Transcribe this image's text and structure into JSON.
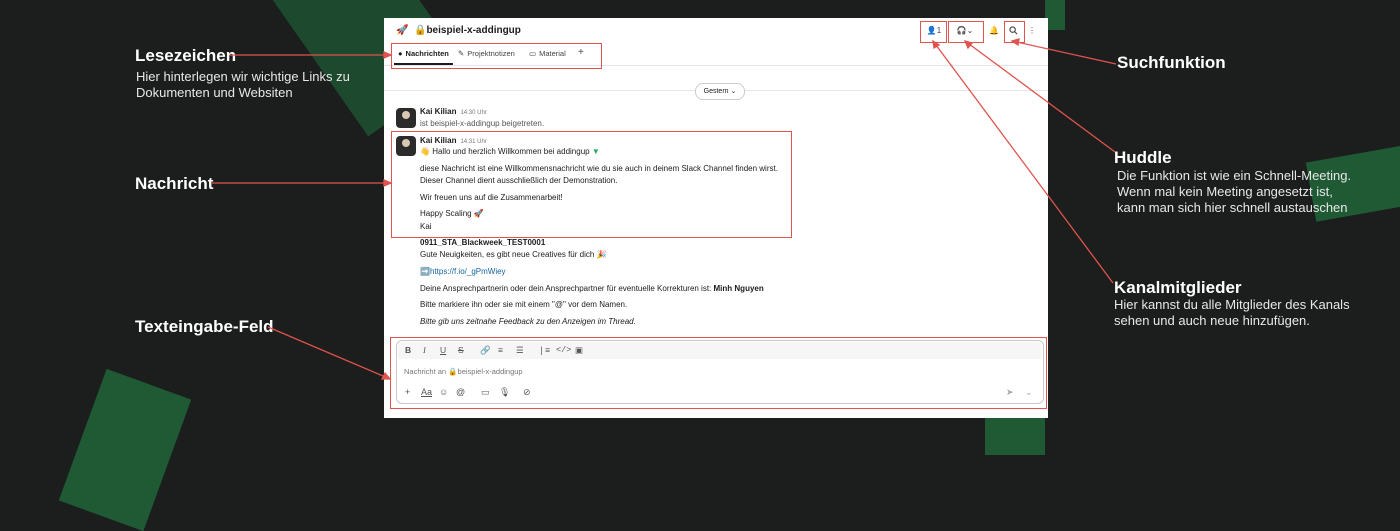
{
  "annotations": {
    "lesezeichen": {
      "title": "Lesezeichen",
      "desc_line1": "Hier hinterlegen wir wichtige Links zu",
      "desc_line2": "Dokumenten und Websiten"
    },
    "nachricht": {
      "title": "Nachricht"
    },
    "texteingabe": {
      "title": "Texteingabe-Feld"
    },
    "suchfunktion": {
      "title": "Suchfunktion"
    },
    "huddle": {
      "title": "Huddle",
      "desc_line1": "Die Funktion ist wie ein Schnell-Meeting.",
      "desc_line2": "Wenn mal kein Meeting angesetzt ist,",
      "desc_line3": "kann man sich hier schnell austauschen"
    },
    "kanalmitglieder": {
      "title": "Kanalmitglieder",
      "desc_line1": "Hier kannst du alle Mitglieder des Kanals",
      "desc_line2": "sehen und auch neue hinzufügen."
    }
  },
  "header": {
    "channel_name": "beispiel-x-addingup",
    "member_count": "1"
  },
  "tabs": [
    {
      "label": "Nachrichten"
    },
    {
      "label": "Projektnotizen"
    },
    {
      "label": "Material"
    }
  ],
  "date_divider": "Gestern",
  "messages": [
    {
      "author": "Kai Kilian",
      "time": "14:30 Uhr",
      "text": "ist beispiel-x-addingup beigetreten."
    },
    {
      "author": "Kai Kilian",
      "time": "14:31 Uhr",
      "line1": "Hallo und herzlich Willkommen bei addingup",
      "line2": "diese Nachricht ist eine Willkommensnachricht wie du sie auch in deinem Slack Channel finden wirst.",
      "line3": "Dieser Channel dient ausschließlich der Demonstration.",
      "line4": "Wir freuen uns auf die Zusammenarbeit!",
      "line5": "Happy Scaling",
      "line6": "Kai"
    }
  ],
  "post": {
    "title": "0911_STA_Blackweek_TEST0001",
    "line1": "Gute Neuigkeiten, es gibt neue Creatives für dich",
    "link": "https://f.io/_gPmWiey",
    "line3_prefix": "Deine Ansprechpartnerin oder dein Ansprechpartner für eventuelle Korrekturen ist: ",
    "line3_name": "Minh Nguyen",
    "line4": "Bitte markiere ihn oder sie mit einem \"@\" vor dem Namen.",
    "line5": "Bitte gib uns zeitnahe Feedback zu den Anzeigen im Thread."
  },
  "composer": {
    "placeholder_prefix": "Nachricht an",
    "placeholder_channel": "beispiel-x-addingup"
  },
  "colors": {
    "accent_red": "#e0534e",
    "background": "#1b1e1c",
    "deco_green": "#1f5a35"
  }
}
